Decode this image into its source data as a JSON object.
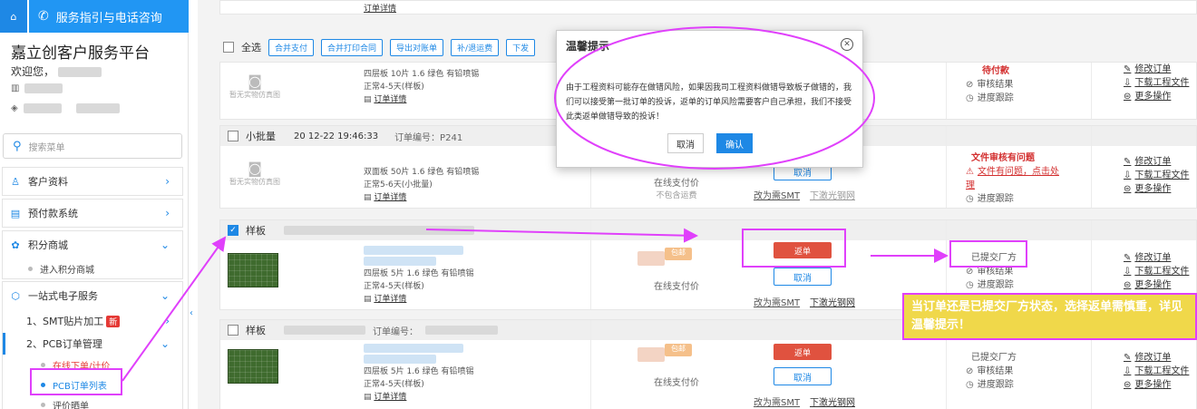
{
  "topbar": {
    "service_label": "服务指引与电话咨询"
  },
  "sidebar": {
    "title": "嘉立创客户服务平台",
    "welcome": "欢迎您，",
    "search_placeholder": "搜索菜单",
    "menu": [
      {
        "label": "客户资料"
      },
      {
        "label": "预付款系统"
      },
      {
        "label": "积分商城",
        "sub": [
          "进入积分商城"
        ]
      },
      {
        "label": "一站式电子服务"
      }
    ],
    "one_stop": {
      "smt": "1、SMT贴片加工",
      "new_badge": "新",
      "pcb": "2、PCB订单管理",
      "pcb_sub": [
        "在线下单/计价",
        "PCB订单列表",
        "评价晒单"
      ]
    }
  },
  "toolbar": {
    "select_all": "全选",
    "buttons": [
      "合并支付",
      "合并打印合同",
      "导出对账单",
      "补/退运费",
      "下发"
    ]
  },
  "orders": [
    {
      "thumb_text": "暂无实物仿真图",
      "spec1": "四层板   10片   1.6   绿色   有铅喷锡",
      "spec2": "正常4-5天(样板)",
      "detail": "订单详情",
      "status": "待付款",
      "status_links": [
        "审核结果",
        "进度跟踪"
      ],
      "ops": [
        "修改订单",
        "下载工程文件",
        "更多操作"
      ]
    },
    {
      "type": "小批量",
      "head_time": "20     12-22 19:46:33",
      "head_no": "订单编号：P241",
      "thumb_text": "暂无实物仿真图",
      "spec1": "双面板   50片   1.6   绿色   有铅喷锡",
      "spec2": "正常5-6天(小批量)",
      "detail": "订单详情",
      "pay": "在线支付价",
      "pay_sub": "不包含运费",
      "cancel": "取消",
      "smt_link": "改为需SMT",
      "laser_link": "下激光钢网",
      "status": "文件审核有问题",
      "status_warn": "文件有问题，点击处理",
      "status_links": [
        "进度跟踪"
      ],
      "ops": [
        "修改订单",
        "下载工程文件",
        "更多操作"
      ]
    },
    {
      "type": "样板",
      "spec1": "四层板   5片   1.6   绿色   有铅喷锡",
      "spec2": "正常4-5天(样板)",
      "detail": "订单详情",
      "pay": "在线支付价",
      "tag": "包邮",
      "return_btn": "返单",
      "cancel": "取消",
      "smt_link": "改为需SMT",
      "laser_link": "下激光钢网",
      "status": "已提交厂方",
      "status_links": [
        "审核结果",
        "进度跟踪"
      ],
      "ops": [
        "修改订单",
        "下载工程文件",
        "更多操作"
      ]
    },
    {
      "type": "样板",
      "head_no": "订单编号：",
      "spec1": "四层板   5片   1.6   绿色   有铅喷锡",
      "spec2": "正常4-5天(样板)",
      "detail": "订单详情",
      "pay": "在线支付价",
      "tag": "包邮",
      "return_btn": "返单",
      "cancel": "取消",
      "smt_link": "改为需SMT",
      "laser_link": "下激光钢网",
      "status": "已提交厂方",
      "status_links": [
        "审核结果",
        "进度跟踪"
      ],
      "ops": [
        "修改订单",
        "下载工程文件",
        "更多操作"
      ]
    }
  ],
  "modal": {
    "title": "温馨提示",
    "body": "由于工程资料可能存在做错风险，如果因我司工程资料做错导致板子做错的，我们可以接受第一批订单的投诉，返单的订单风险需要客户自己承担，我们不接受此类返单做错导致的投诉！",
    "cancel": "取消",
    "confirm": "确认"
  },
  "annotation": {
    "note": "当订单还是已提交厂方状态，选择返单需慎重，详见温馨提示！",
    "color": "#e040fb"
  },
  "colors": {
    "primary": "#1e88e5",
    "danger": "#e0523f",
    "highlight": "#f0d84a"
  }
}
